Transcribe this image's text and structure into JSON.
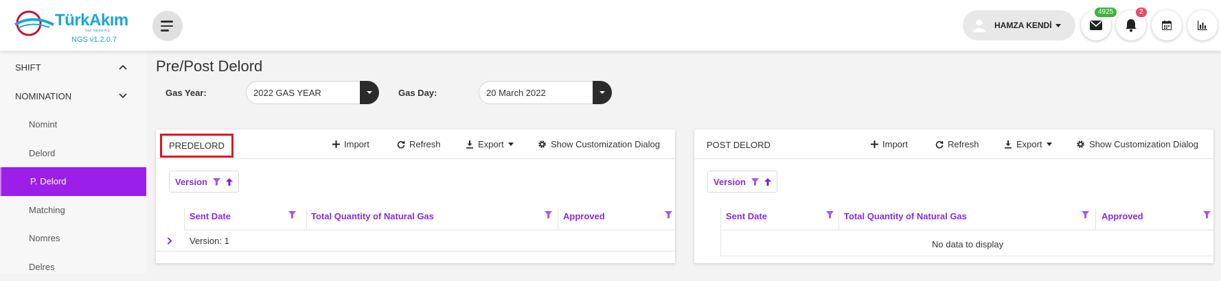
{
  "brand": {
    "name": "TürkAkım",
    "tagline": "Gaz Taşıma A.Ş.",
    "version": "NGS v1.2.0.7"
  },
  "header": {
    "user_name": "HAMZA KENDİ",
    "mail_count": "4925",
    "notification_count": "2",
    "badge_colors": {
      "mail": "#3fb23f",
      "notification": "#e84a6a"
    }
  },
  "sidebar": {
    "items": [
      {
        "label": "SHIFT",
        "level": "top",
        "expanded": true
      },
      {
        "label": "NOMINATION",
        "level": "top",
        "expanded": false
      },
      {
        "label": "Nomint",
        "level": "sub"
      },
      {
        "label": "Delord",
        "level": "sub"
      },
      {
        "label": "P. Delord",
        "level": "sub",
        "active": true
      },
      {
        "label": "Matching",
        "level": "sub"
      },
      {
        "label": "Nomres",
        "level": "sub"
      },
      {
        "label": "Delres",
        "level": "sub"
      }
    ]
  },
  "page": {
    "title": "Pre/Post Delord",
    "gas_year_label": "Gas Year:",
    "gas_year_value": "2022 GAS YEAR",
    "gas_day_label": "Gas Day:",
    "gas_day_value": "20 March 2022"
  },
  "panels": {
    "pre": {
      "title": "PREDELORD",
      "import_label": "Import",
      "refresh_label": "Refresh",
      "export_label": "Export",
      "customize_label": "Show Customization Dialog",
      "group_label": "Version",
      "columns": [
        "Sent Date",
        "Total Quantity of Natural Gas",
        "Approved"
      ],
      "group_row": "Version: 1"
    },
    "post": {
      "title": "POST DELORD",
      "import_label": "Import",
      "refresh_label": "Refresh",
      "export_label": "Export",
      "customize_label": "Show Customization Dialog",
      "group_label": "Version",
      "columns": [
        "Sent Date",
        "Total Quantity of Natural Gas",
        "Approved"
      ],
      "empty_text": "No data to display"
    }
  },
  "colors": {
    "accent": "#9b1fe8",
    "column_text": "#8a2be2",
    "highlight_box": "#e0141e"
  }
}
